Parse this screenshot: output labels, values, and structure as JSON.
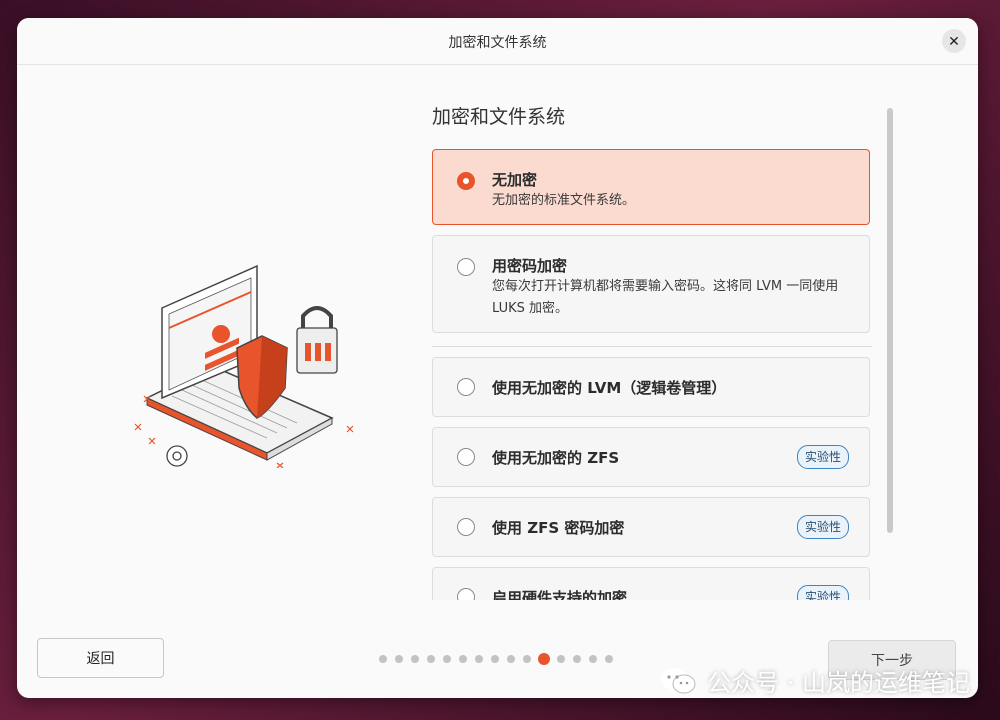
{
  "window": {
    "title": "加密和文件系统",
    "close_icon": "close-icon"
  },
  "main": {
    "heading": "加密和文件系统",
    "options": [
      {
        "title": "无加密",
        "desc": "无加密的标准文件系统。",
        "selected": true
      },
      {
        "title": "用密码加密",
        "desc": "您每次打开计算机都将需要输入密码。这将同 LVM 一同使用 LUKS 加密。",
        "selected": false
      },
      {
        "title": "使用无加密的 LVM（逻辑卷管理）",
        "selected": false
      },
      {
        "title": "使用无加密的 ZFS",
        "badge": "实验性",
        "selected": false
      },
      {
        "title": "使用 ZFS 密码加密",
        "badge": "实验性",
        "selected": false
      },
      {
        "title": "启用硬件支持的加密",
        "badge": "实验性",
        "selected": false
      }
    ]
  },
  "footer": {
    "back_label": "返回",
    "next_label": "下一步",
    "progress": {
      "total": 15,
      "current": 11
    }
  },
  "watermark": {
    "text": "公众号 · 山岚的运维笔记"
  },
  "colors": {
    "accent": "#e8542c",
    "selected_bg": "#fbdad0",
    "badge_border": "#3c84c4"
  }
}
